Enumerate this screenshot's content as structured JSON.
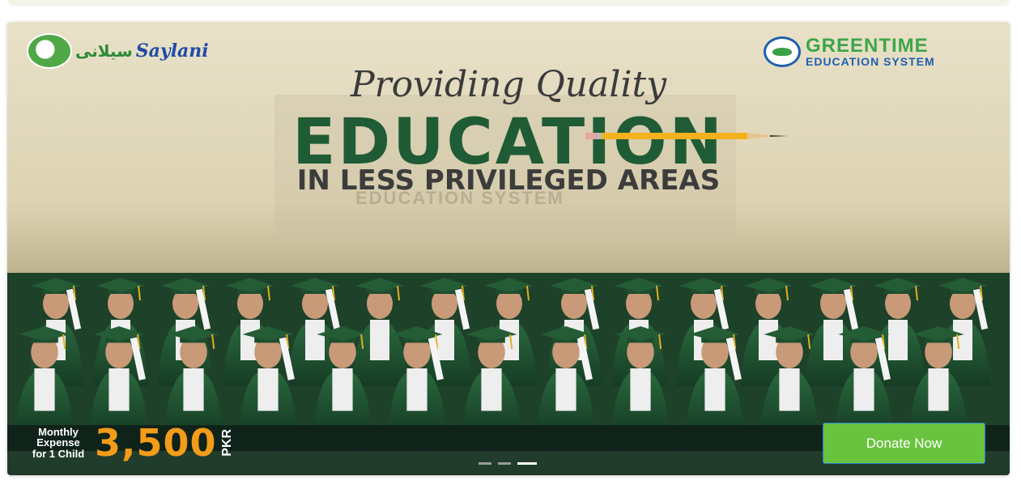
{
  "banner": {
    "left_logo": {
      "text_latin": "Saylani",
      "text_urdu": "سیلانی",
      "icon": "saylani-logo-icon"
    },
    "right_logo": {
      "line1": "GREENTIME",
      "line2": "EDUCATION SYSTEM",
      "icon": "greentime-logo-icon"
    },
    "headline_script": "Providing Quality",
    "headline_main": "EDUCATION",
    "headline_sub": "IN LESS PRIVILEGED AREAS",
    "background_sign": "EDUCATION SYSTEM",
    "expense": {
      "label_line1": "Monthly",
      "label_line2": "Expense",
      "label_line3": "for 1 Child",
      "amount": "3,500",
      "currency": "PKR"
    },
    "donate_label": "Donate Now"
  },
  "carousel": {
    "slide_count": 3,
    "active_index": 2
  },
  "colors": {
    "donate_bg": "#6ac33f",
    "headline_green": "#1f5b35",
    "amount_orange": "#f39c19",
    "gown_green": "#1f5a33"
  }
}
